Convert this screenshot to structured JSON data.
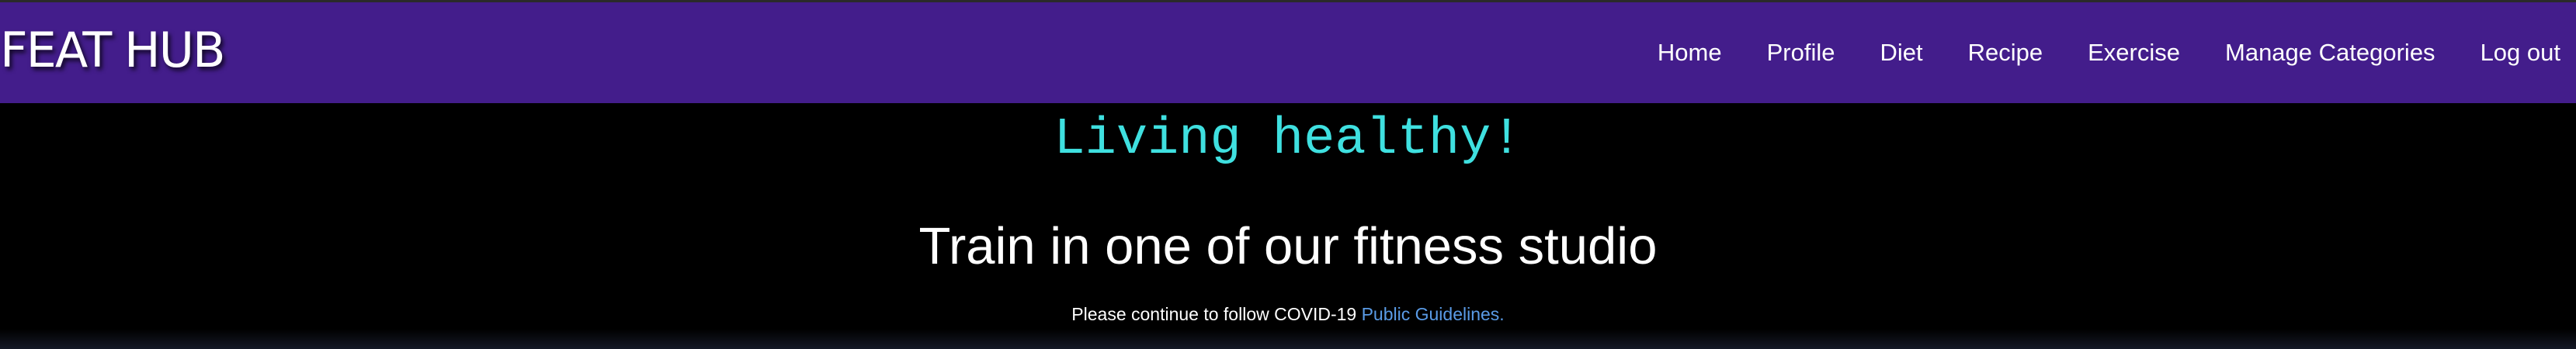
{
  "brand": {
    "name": "FEAT HUB"
  },
  "nav": {
    "items": [
      {
        "label": "Home"
      },
      {
        "label": "Profile"
      },
      {
        "label": "Diet"
      },
      {
        "label": "Recipe"
      },
      {
        "label": "Exercise"
      },
      {
        "label": "Manage Categories"
      },
      {
        "label": "Log out"
      }
    ]
  },
  "hero": {
    "tagline": "Living healthy!",
    "headline": "Train in one of our fitness studio",
    "notice_text": "Please continue to follow COVID-19 ",
    "notice_link": "Public Guidelines."
  },
  "colors": {
    "navbar_bg": "#431d8b",
    "page_bg": "#000000",
    "tagline": "#3fe0e0",
    "link": "#5a9be6"
  }
}
